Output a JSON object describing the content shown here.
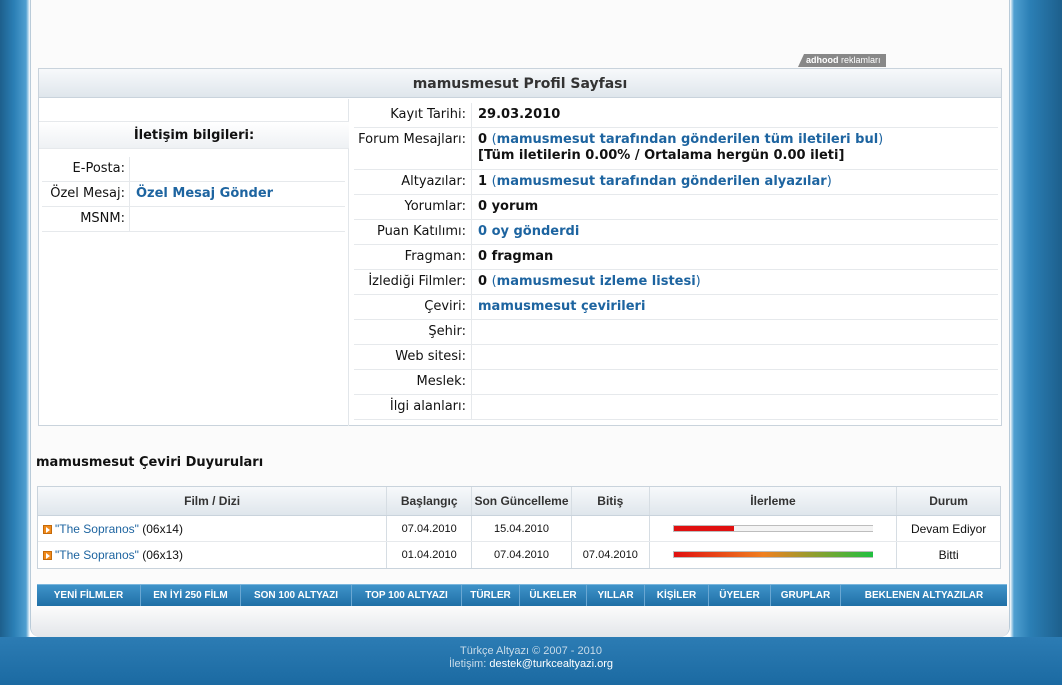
{
  "ad": {
    "brand": "adhood",
    "text": "reklamları"
  },
  "profile": {
    "title": "mamusmesut Profil Sayfası",
    "contact": {
      "heading": "İletişim bilgileri:",
      "rows": [
        {
          "label": "E-Posta:",
          "value": ""
        },
        {
          "label": "Özel Mesaj:",
          "value": "Özel Mesaj Gönder"
        },
        {
          "label": "MSNM:",
          "value": ""
        }
      ]
    },
    "info": {
      "registered": {
        "label": "Kayıt Tarihi:",
        "value": "29.03.2010"
      },
      "forum": {
        "label": "Forum Mesajları:",
        "count": "0",
        "link": "mamusmesut tarafından gönderilen tüm iletileri bul",
        "stats": "[Tüm iletilerin 0.00% / Ortalama hergün 0.00 ileti]"
      },
      "subtitles": {
        "label": "Altyazılar:",
        "count": "1",
        "link": "mamusmesut tarafından gönderilen alyazılar"
      },
      "comments": {
        "label": "Yorumlar:",
        "value": "0 yorum"
      },
      "rating": {
        "label": "Puan Katılımı:",
        "value": "0 oy gönderdi"
      },
      "trailer": {
        "label": "Fragman:",
        "value": "0 fragman"
      },
      "watched": {
        "label": "İzlediği Filmler:",
        "count": "0",
        "link": "mamusmesut izleme listesi"
      },
      "translations": {
        "label": "Çeviri:",
        "value": "mamusmesut çevirileri"
      },
      "city": {
        "label": "Şehir:",
        "value": ""
      },
      "website": {
        "label": "Web sitesi:",
        "value": ""
      },
      "job": {
        "label": "Meslek:",
        "value": ""
      },
      "interests": {
        "label": "İlgi alanları:",
        "value": ""
      }
    }
  },
  "announcements": {
    "title": "mamusmesut Çeviri Duyuruları",
    "headers": [
      "Film / Dizi",
      "Başlangıç",
      "Son Güncelleme",
      "Bitiş",
      "İlerleme",
      "Durum"
    ],
    "rows": [
      {
        "title": "\"The Sopranos\"",
        "episode": "(06x14)",
        "start": "07.04.2010",
        "updated": "15.04.2010",
        "end": "",
        "progress": 0.3,
        "status": "Devam Ediyor"
      },
      {
        "title": "\"The Sopranos\"",
        "episode": "(06x13)",
        "start": "01.04.2010",
        "updated": "07.04.2010",
        "end": "07.04.2010",
        "progress": 1.0,
        "status": "Bitti"
      }
    ]
  },
  "nav": [
    "YENİ FİLMLER",
    "EN İYİ 250 FİLM",
    "SON 100 ALTYAZI",
    "TOP 100 ALTYAZI",
    "TÜRLER",
    "ÜLKELER",
    "YILLAR",
    "KİŞİLER",
    "ÜYELER",
    "GRUPLAR",
    "BEKLENEN ALTYAZILAR"
  ],
  "footer": {
    "copyright": "Türkçe Altyazı © 2007 - 2010",
    "contact_label": "İletişim:",
    "contact_email": "destek@turkcealtyazi.org"
  },
  "colors": {
    "link": "#1d64a0",
    "nav": "#2a80ba",
    "progress_start": "#e01010",
    "progress_end": "#20c040"
  }
}
